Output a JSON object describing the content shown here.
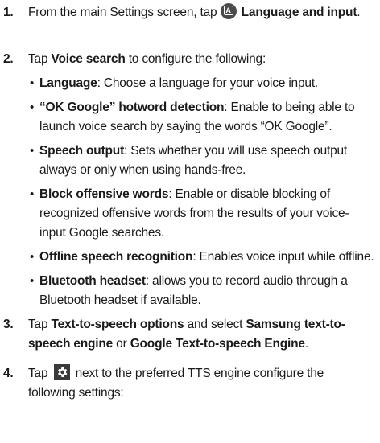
{
  "steps": [
    {
      "number": "1.",
      "pre": "From the main Settings screen, tap ",
      "icon": "a-circle-icon",
      "icon_letter": "A",
      "bold": "Language and input",
      "post": "."
    },
    {
      "number": "2.",
      "pre": "Tap ",
      "bold": "Voice search",
      "post": " to configure the following:"
    },
    {
      "number": "3.",
      "pre": "Tap ",
      "bold1": "Text-to-speech options",
      "mid": " and select ",
      "bold2": "Samsung text-to-speech engine",
      "mid2": " or ",
      "bold3": "Google Text-to-speech Engine",
      "post": "."
    },
    {
      "number": "4.",
      "pre": "Tap ",
      "icon": "gear-icon",
      "post": " next to the preferred TTS engine configure the following settings:"
    }
  ],
  "bullets": [
    {
      "term": "Language",
      "desc": ": Choose a language for your voice input."
    },
    {
      "term": "“OK Google” hotword detection",
      "desc": ": Enable to being able to launch voice search by saying the words “OK Google”."
    },
    {
      "term": "Speech output",
      "desc": ": Sets whether you will use speech output always or only when using hands-free."
    },
    {
      "term": "Block offensive words",
      "desc": ": Enable or disable blocking of recognized offensive words from the results of your voice-input Google searches."
    },
    {
      "term": "Offline speech recognition",
      "desc": ": Enables voice input while offline."
    },
    {
      "term": "Bluetooth headset",
      "desc": ": allows you to record audio through a Bluetooth headset if available."
    }
  ],
  "bullet_char": "•",
  "colors": {
    "text": "#1a1a1a",
    "icon_bg": "#4a4a4a"
  }
}
